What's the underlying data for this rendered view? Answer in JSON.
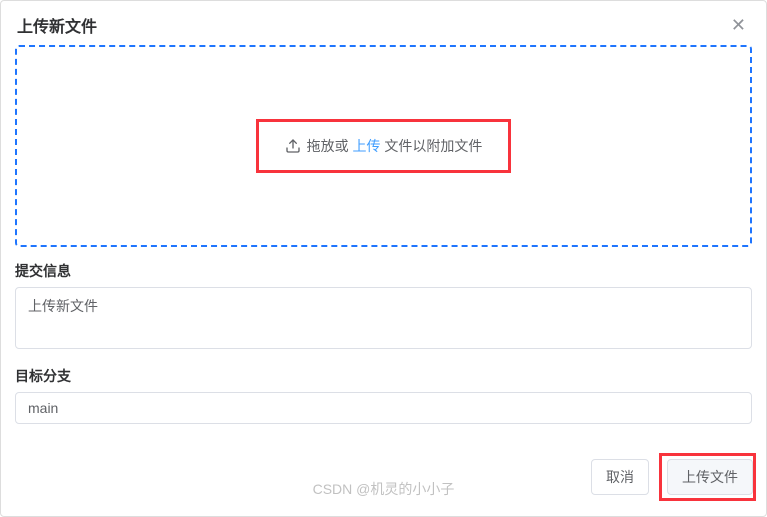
{
  "modal": {
    "title": "上传新文件"
  },
  "dropzone": {
    "prefix": "拖放或",
    "link": "上传",
    "suffix": "文件以附加文件"
  },
  "form": {
    "commit_label": "提交信息",
    "commit_value": "上传新文件",
    "branch_label": "目标分支",
    "branch_value": "main"
  },
  "footer": {
    "cancel": "取消",
    "submit": "上传文件"
  },
  "watermark": "CSDN @机灵的小小子"
}
